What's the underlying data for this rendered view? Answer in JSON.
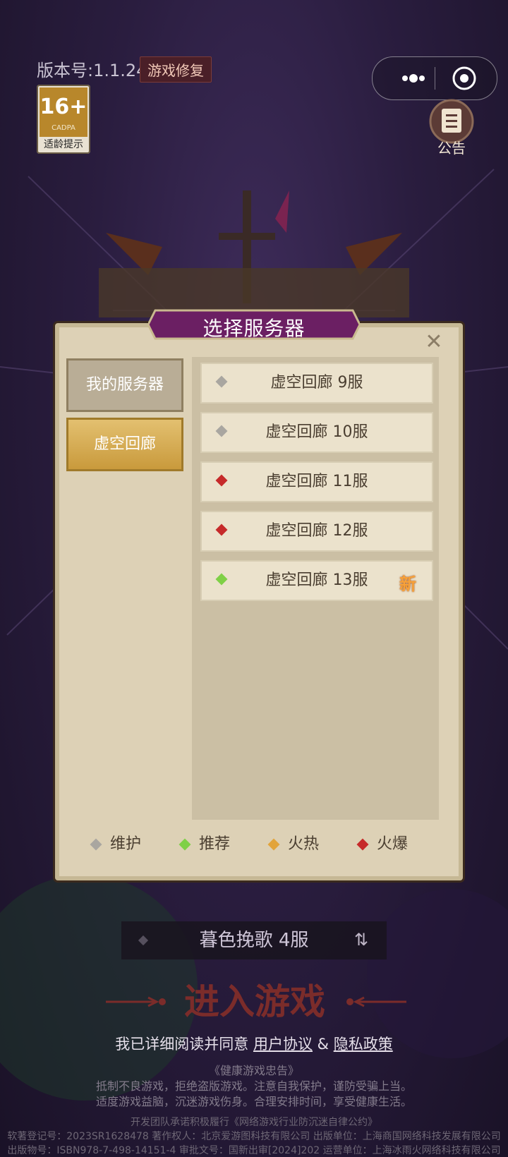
{
  "top": {
    "version": "版本号:1.1.24",
    "fix_button": "游戏修复",
    "age_badge": {
      "rating": "16+",
      "org": "CADPA",
      "label": "适龄提示"
    },
    "notice_label": "公告"
  },
  "dialog": {
    "title": "选择服务器",
    "tabs": [
      {
        "label": "我的服务器",
        "selected": false
      },
      {
        "label": "虚空回廊",
        "selected": true
      }
    ],
    "servers": [
      {
        "name": "虚空回廊 9服",
        "status": "维护",
        "badge": ""
      },
      {
        "name": "虚空回廊 10服",
        "status": "维护",
        "badge": ""
      },
      {
        "name": "虚空回廊 11服",
        "status": "火爆",
        "badge": ""
      },
      {
        "name": "虚空回廊 12服",
        "status": "火爆",
        "badge": ""
      },
      {
        "name": "虚空回廊 13服",
        "status": "推荐",
        "badge": "新"
      }
    ],
    "legend": [
      {
        "label": "维护",
        "color": "#a9a6a0"
      },
      {
        "label": "推荐",
        "color": "#7fd046"
      },
      {
        "label": "火热",
        "color": "#e2a43a"
      },
      {
        "label": "火爆",
        "color": "#c62a2a"
      }
    ]
  },
  "bottom": {
    "current_server": "暮色挽歌 4服",
    "enter_button": "进入游戏",
    "agree_prefix": "我已详细阅读并同意 ",
    "user_agreement": "用户协议",
    "agree_and": " & ",
    "privacy_policy": "隐私政策",
    "health_title": "《健康游戏忠告》",
    "health_line1": "抵制不良游戏，拒绝盗版游戏。注意自我保护，谨防受骗上当。",
    "health_line2": "适度游戏益脑，沉迷游戏伤身。合理安排时间，享受健康生活。",
    "footer_line1": "开发团队承诺积极履行《网络游戏行业防沉迷自律公约》",
    "footer_line2": "软著登记号：2023SR1628478 著作权人：北京爱游图科技有限公司 出版单位：上海商国网络科技发展有限公司",
    "footer_line3": "出版物号：ISBN978-7-498-14151-4 审批文号：国新出审[2024]202 运营单位：上海冰雨火网络科技有限公司"
  },
  "colors": {
    "dialog_bg": "#ddd1b6",
    "tab_selected": "#d1a84e",
    "enter_text": "#7b2c2a"
  }
}
